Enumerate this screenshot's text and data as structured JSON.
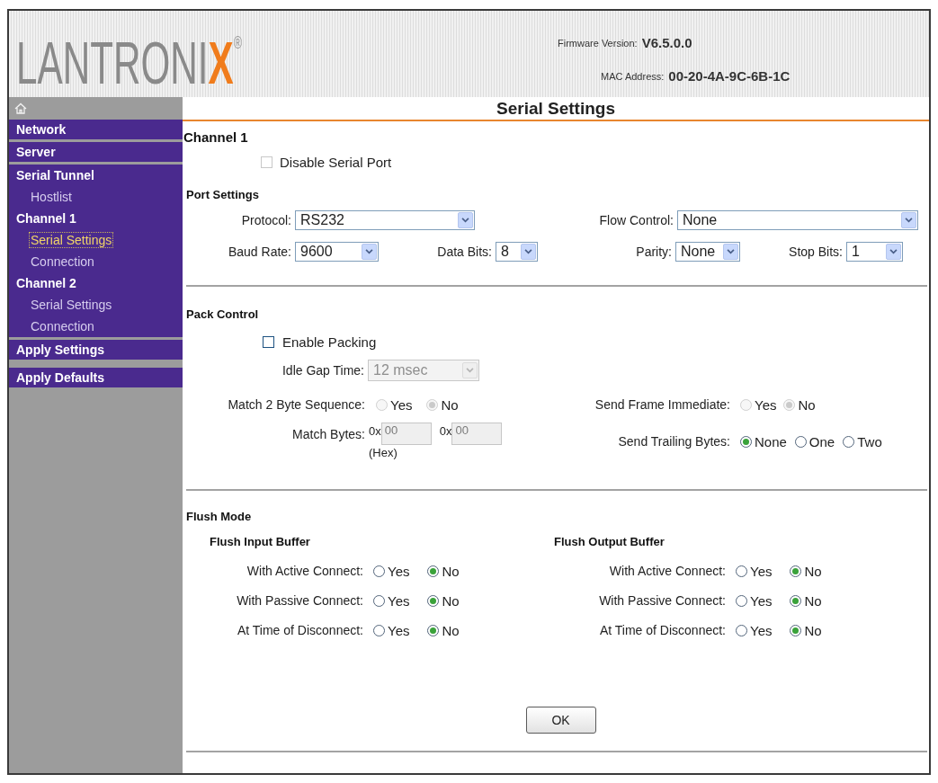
{
  "header": {
    "logo": {
      "text": "LANTRONI",
      "accent": "X",
      "mark": "®"
    },
    "firmware": {
      "label": "Firmware Version:",
      "value": "V6.5.0.0"
    },
    "mac": {
      "label": "MAC Address:",
      "value": "00-20-4A-9C-6B-1C"
    }
  },
  "sidebar": {
    "blocks": [
      {
        "kind": "menu",
        "headings": [
          {
            "label": "Network"
          }
        ]
      },
      {
        "kind": "menu",
        "headings": [
          {
            "label": "Server"
          }
        ]
      },
      {
        "kind": "menu",
        "headings": [
          {
            "label": "Serial Tunnel",
            "children": [
              {
                "label": "Hostlist",
                "selected": false
              }
            ]
          },
          {
            "label": "Channel 1",
            "children": [
              {
                "label": "Serial Settings",
                "selected": true
              },
              {
                "label": "Connection",
                "selected": false
              }
            ]
          },
          {
            "label": "Channel 2",
            "children": [
              {
                "label": "Serial Settings",
                "selected": false
              },
              {
                "label": "Connection",
                "selected": false
              }
            ]
          }
        ]
      },
      {
        "kind": "action",
        "headings": [
          {
            "label": "Apply Settings"
          }
        ]
      },
      {
        "kind": "action",
        "headings": [
          {
            "label": "Apply Defaults"
          }
        ]
      }
    ]
  },
  "page_title": "Serial Settings",
  "channel": {
    "title": "Channel 1",
    "disable_serial_port": {
      "label": "Disable Serial Port",
      "checked": false
    }
  },
  "port_settings": {
    "title": "Port Settings",
    "protocol": {
      "label": "Protocol:",
      "value": "RS232"
    },
    "flow_control": {
      "label": "Flow Control:",
      "value": "None"
    },
    "baud_rate": {
      "label": "Baud Rate:",
      "value": "9600"
    },
    "data_bits": {
      "label": "Data Bits:",
      "value": "8"
    },
    "parity": {
      "label": "Parity:",
      "value": "None"
    },
    "stop_bits": {
      "label": "Stop Bits:",
      "value": "1"
    }
  },
  "pack_control": {
    "title": "Pack Control",
    "enable_packing": {
      "label": "Enable Packing",
      "checked": false
    },
    "idle_gap_time": {
      "label": "Idle Gap Time:",
      "value": "12 msec",
      "disabled": true
    },
    "match_2_byte_sequence": {
      "label": "Match 2 Byte Sequence:",
      "disabled": true,
      "options": [
        {
          "label": "Yes",
          "selected": false
        },
        {
          "label": "No",
          "selected": true
        }
      ]
    },
    "send_frame_immediate": {
      "label": "Send Frame Immediate:",
      "disabled": true,
      "options": [
        {
          "label": "Yes",
          "selected": false
        },
        {
          "label": "No",
          "selected": true
        }
      ]
    },
    "match_bytes": {
      "label": "Match Bytes:",
      "disabled": true,
      "fields": [
        {
          "prefix": "0x",
          "value": "00"
        },
        {
          "prefix": "0x",
          "value": "00"
        }
      ],
      "note": "(Hex)"
    },
    "send_trailing_bytes": {
      "label": "Send Trailing Bytes:",
      "options": [
        {
          "label": "None",
          "selected": true
        },
        {
          "label": "One",
          "selected": false
        },
        {
          "label": "Two",
          "selected": false
        }
      ]
    }
  },
  "flush_mode": {
    "title": "Flush Mode",
    "groups": [
      {
        "title": "Flush Input Buffer",
        "rows": [
          {
            "label": "With Active Connect:",
            "options": [
              {
                "label": "Yes",
                "selected": false
              },
              {
                "label": "No",
                "selected": true
              }
            ]
          },
          {
            "label": "With Passive Connect:",
            "options": [
              {
                "label": "Yes",
                "selected": false
              },
              {
                "label": "No",
                "selected": true
              }
            ]
          },
          {
            "label": "At Time of Disconnect:",
            "options": [
              {
                "label": "Yes",
                "selected": false
              },
              {
                "label": "No",
                "selected": true
              }
            ]
          }
        ]
      },
      {
        "title": "Flush Output Buffer",
        "rows": [
          {
            "label": "With Active Connect:",
            "options": [
              {
                "label": "Yes",
                "selected": false
              },
              {
                "label": "No",
                "selected": true
              }
            ]
          },
          {
            "label": "With Passive Connect:",
            "options": [
              {
                "label": "Yes",
                "selected": false
              },
              {
                "label": "No",
                "selected": true
              }
            ]
          },
          {
            "label": "At Time of Disconnect:",
            "options": [
              {
                "label": "Yes",
                "selected": false
              },
              {
                "label": "No",
                "selected": true
              }
            ]
          }
        ]
      }
    ]
  },
  "ok_button": "OK"
}
